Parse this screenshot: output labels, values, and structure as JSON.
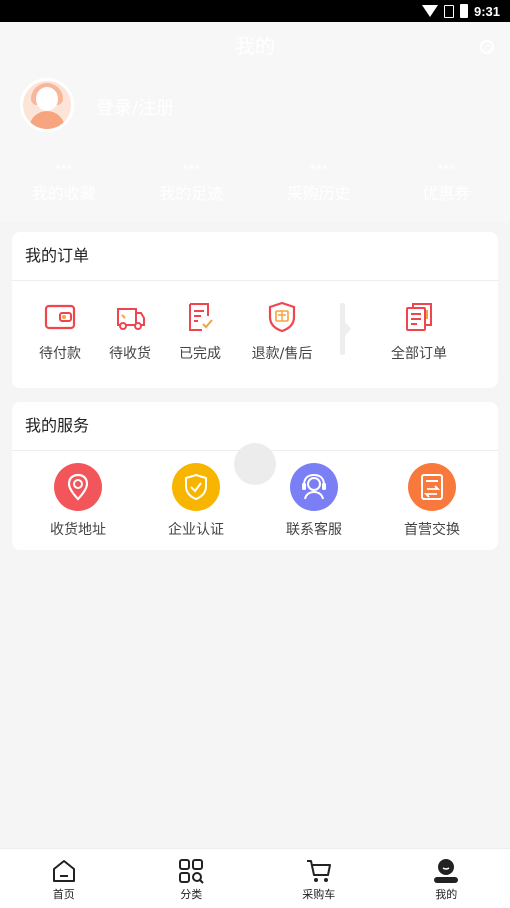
{
  "status_bar": {
    "time": "9:31"
  },
  "header": {
    "title": "我的",
    "login_text": "登录/注册",
    "stats": [
      {
        "count": "***",
        "label": "我的收藏"
      },
      {
        "count": "***",
        "label": "我的足迹"
      },
      {
        "count": "***",
        "label": "采购历史"
      },
      {
        "count": "***",
        "label": "优惠券"
      }
    ]
  },
  "orders": {
    "title": "我的订单",
    "items": [
      {
        "label": "待付款",
        "icon": "wallet-icon"
      },
      {
        "label": "待收货",
        "icon": "truck-icon"
      },
      {
        "label": "已完成",
        "icon": "checked-doc-icon"
      },
      {
        "label": "退款/售后",
        "icon": "shield-after-sale-icon"
      }
    ],
    "all_label": "全部订单"
  },
  "services": {
    "title": "我的服务",
    "items": [
      {
        "label": "收货地址",
        "icon": "location-pin-icon",
        "color": "#f2555a"
      },
      {
        "label": "企业认证",
        "icon": "shield-check-icon",
        "color": "#f7b500"
      },
      {
        "label": "联系客服",
        "icon": "headset-icon",
        "color": "#7b7ff5"
      },
      {
        "label": "首营交换",
        "icon": "exchange-doc-icon",
        "color": "#f9783c"
      }
    ]
  },
  "bottom_nav": [
    {
      "label": "首页",
      "icon": "home-icon"
    },
    {
      "label": "分类",
      "icon": "category-icon"
    },
    {
      "label": "采购车",
      "icon": "cart-icon"
    },
    {
      "label": "我的",
      "icon": "profile-icon"
    }
  ],
  "colors": {
    "order_icon": "#f0454f",
    "accent_orange": "#f5a33b"
  }
}
